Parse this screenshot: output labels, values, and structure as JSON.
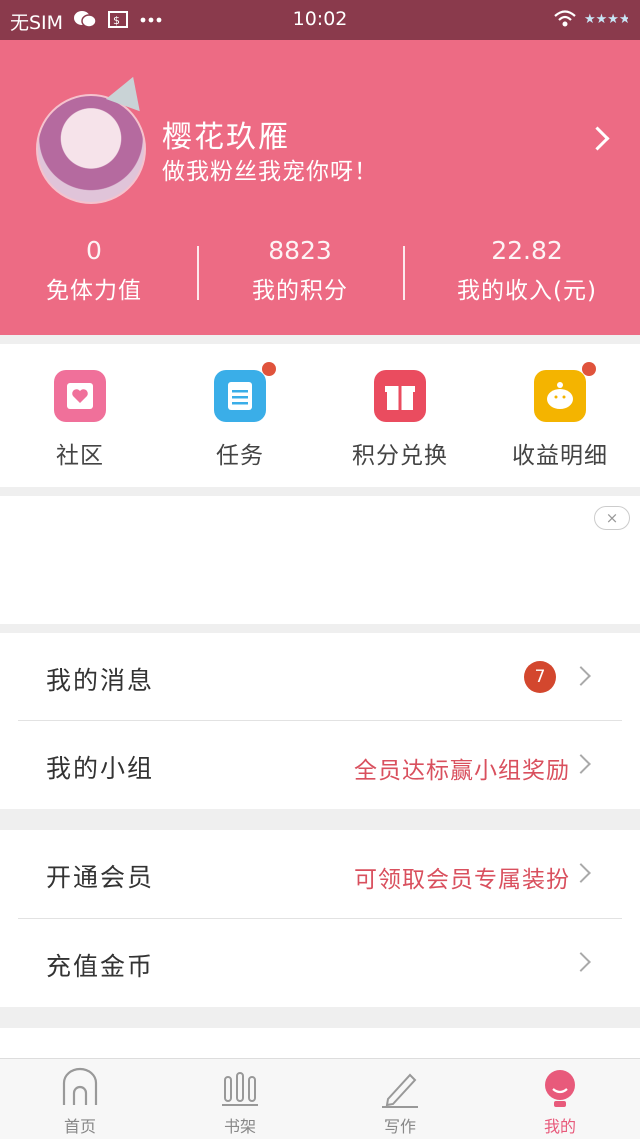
{
  "status_bar": {
    "carrier": "无SIM",
    "time": "10:02",
    "icons": [
      "wechat-icon",
      "screenshot-icon",
      "more-dots-icon",
      "wifi-icon",
      "battery-icon"
    ]
  },
  "profile": {
    "username": "樱花玖雁",
    "signature": "做我粉丝我宠你呀！",
    "stats": [
      {
        "value": "0",
        "label": "免体力值"
      },
      {
        "value": "8823",
        "label": "我的积分"
      },
      {
        "value": "22.82",
        "label": "我的收入(元)"
      }
    ]
  },
  "shortcuts": [
    {
      "label": "社区",
      "icon": "community-heart-icon",
      "color": "#f0709a",
      "has_dot": false
    },
    {
      "label": "任务",
      "icon": "task-list-icon",
      "color": "#3aaee8",
      "has_dot": true
    },
    {
      "label": "积分兑换",
      "icon": "gift-icon",
      "color": "#ea4c5f",
      "has_dot": false
    },
    {
      "label": "收益明细",
      "icon": "piggy-bank-icon",
      "color": "#f4b400",
      "has_dot": true
    }
  ],
  "ad": {
    "close_label": "×"
  },
  "menu_groups": [
    {
      "rows": [
        {
          "title": "我的消息",
          "badge": "7",
          "hint": ""
        },
        {
          "title": "我的小组",
          "hint": "全员达标赢小组奖励"
        }
      ]
    },
    {
      "rows": [
        {
          "title": "开通会员",
          "hint": "可领取会员专属装扮"
        },
        {
          "title": "充值金币",
          "hint": ""
        }
      ]
    }
  ],
  "tabs": [
    {
      "label": "首页",
      "icon": "home-icon",
      "active": false
    },
    {
      "label": "书架",
      "icon": "bookshelf-icon",
      "active": false
    },
    {
      "label": "写作",
      "icon": "pencil-icon",
      "active": false
    },
    {
      "label": "我的",
      "icon": "profile-icon",
      "active": true
    }
  ],
  "colors": {
    "header_pink": "#ed6b84",
    "accent": "#e85a7b",
    "hint_red": "#d9505e",
    "badge_red": "#d3472e",
    "status_bar": "#8a3a4c"
  }
}
